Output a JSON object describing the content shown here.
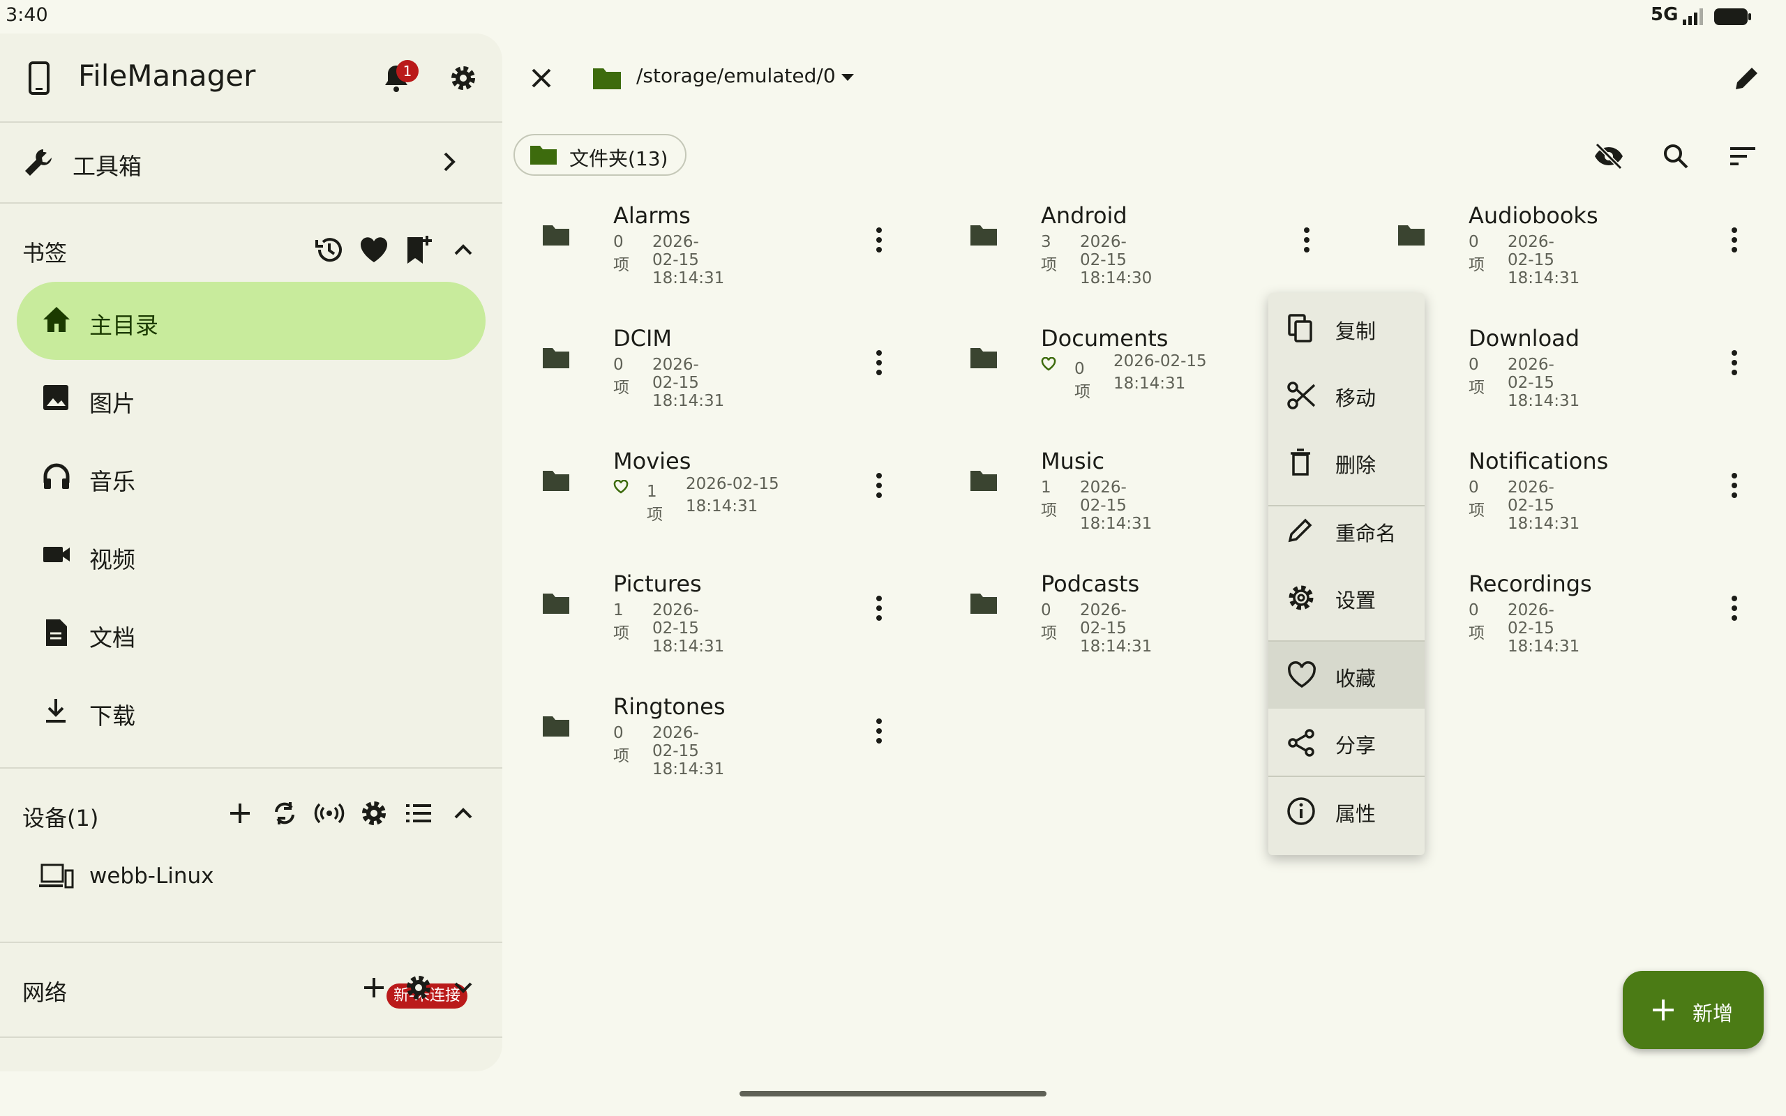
{
  "status": {
    "time": "3:40",
    "network": "5G"
  },
  "drawer": {
    "app_title": "FileManager",
    "notification_count": "1",
    "toolbox_label": "工具箱",
    "bookmarks_title": "书签",
    "bookmarks": [
      {
        "label": "主目录",
        "icon": "home-icon",
        "active": true
      },
      {
        "label": "图片",
        "icon": "image-icon"
      },
      {
        "label": "音乐",
        "icon": "headphones-icon"
      },
      {
        "label": "视频",
        "icon": "video-icon"
      },
      {
        "label": "文档",
        "icon": "document-icon"
      },
      {
        "label": "下载",
        "icon": "download-icon"
      }
    ],
    "devices_title": "设备(1)",
    "device": {
      "name": "webb-Linux",
      "status": "新-未连接"
    },
    "network_title": "网络"
  },
  "toolbar": {
    "path": "/storage/emulated/0"
  },
  "filter_chip": {
    "label": "文件夹(13)"
  },
  "files": [
    {
      "name": "Alarms",
      "count": "0项",
      "date": "2026-02-15 18:14:31"
    },
    {
      "name": "Android",
      "count": "3项",
      "date": "2026-02-15 18:14:30"
    },
    {
      "name": "Audiobooks",
      "count": "0项",
      "date": "2026-02-15 18:14:31"
    },
    {
      "name": "DCIM",
      "count": "0项",
      "date": "2026-02-15 18:14:31"
    },
    {
      "name": "Documents",
      "count": "0项",
      "date": "2026-02-15 18:14:31",
      "favorite": true
    },
    {
      "name": "Download",
      "count": "0项",
      "date": "2026-02-15 18:14:31"
    },
    {
      "name": "Movies",
      "count": "1项",
      "date": "2026-02-15 18:14:31",
      "favorite": true
    },
    {
      "name": "Music",
      "count": "1项",
      "date": "2026-02-15 18:14:31"
    },
    {
      "name": "Notifications",
      "count": "0项",
      "date": "2026-02-15 18:14:31"
    },
    {
      "name": "Pictures",
      "count": "1项",
      "date": "2026-02-15 18:14:31"
    },
    {
      "name": "Podcasts",
      "count": "0项",
      "date": "2026-02-15 18:14:31"
    },
    {
      "name": "Recordings",
      "count": "0项",
      "date": "2026-02-15 18:14:31"
    },
    {
      "name": "Ringtones",
      "count": "0项",
      "date": "2026-02-15 18:14:31"
    }
  ],
  "context_menu": {
    "items": [
      {
        "label": "复制",
        "icon": "copy-icon"
      },
      {
        "label": "移动",
        "icon": "cut-icon"
      },
      {
        "label": "删除",
        "icon": "delete-icon"
      },
      {
        "label": "重命名",
        "icon": "pencil-icon"
      },
      {
        "label": "设置",
        "icon": "gear-icon"
      },
      {
        "label": "收藏",
        "icon": "heart-icon",
        "highlighted": true
      },
      {
        "label": "分享",
        "icon": "share-icon"
      },
      {
        "label": "属性",
        "icon": "info-icon"
      }
    ]
  },
  "fab": {
    "label": "新增"
  },
  "colors": {
    "accent": "#4b7b15",
    "active_nav": "#c8eb9c",
    "badge": "#ba1a1a",
    "folder": "#3a4430"
  }
}
